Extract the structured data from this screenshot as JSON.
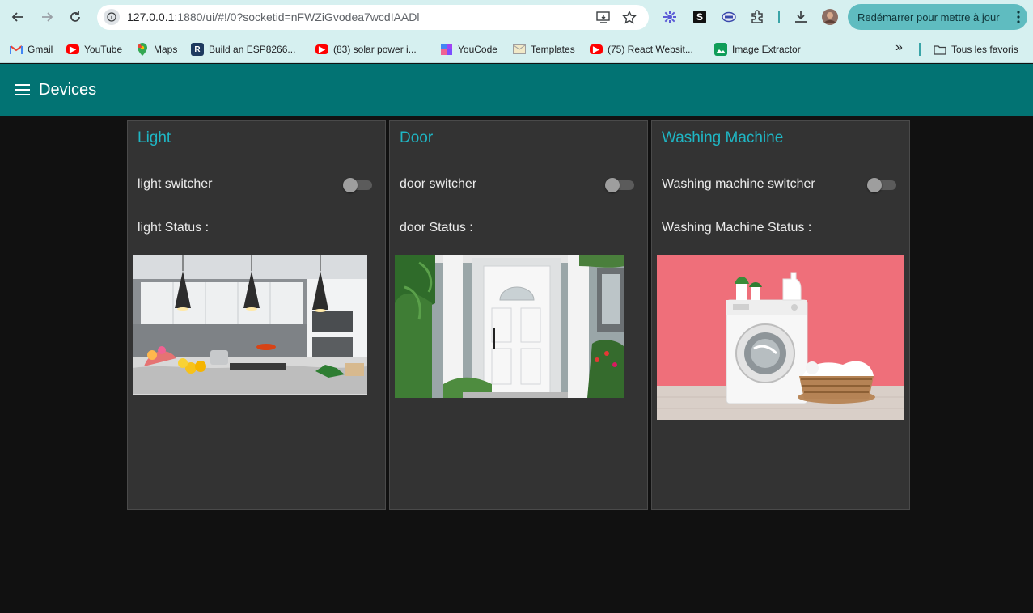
{
  "browser": {
    "url_host": "127.0.0.1",
    "url_rest": ":1880/ui/#!/0?socketid=nFWZiGvodea7wcdIAADl",
    "restart_label": "Redémarrer pour mettre à jour"
  },
  "bookmarks": [
    {
      "label": "Gmail",
      "icon": "gmail-icon"
    },
    {
      "label": "YouTube",
      "icon": "youtube-icon"
    },
    {
      "label": "Maps",
      "icon": "maps-icon"
    },
    {
      "label": "Build an ESP8266...",
      "icon": "r-icon"
    },
    {
      "label": "(83) solar power i...",
      "icon": "youtube-icon"
    },
    {
      "label": "YouCode",
      "icon": "youcode-icon"
    },
    {
      "label": "Templates",
      "icon": "envelope-icon"
    },
    {
      "label": "(75) React Websit...",
      "icon": "youtube-icon"
    },
    {
      "label": "Image Extractor",
      "icon": "image-icon"
    }
  ],
  "bookmarks_more": "»",
  "all_bookmarks_label": "Tous les favoris",
  "dashboard": {
    "title": "Devices",
    "colors": {
      "toolbar": "#027373",
      "accent": "#1fb6c4",
      "card": "#333333"
    },
    "cards": [
      {
        "title": "Light",
        "switch_label": "light switcher",
        "switch_on": false,
        "status_label": "light Status :",
        "image": "kitchen-image"
      },
      {
        "title": "Door",
        "switch_label": "door switcher",
        "switch_on": false,
        "status_label": "door Status :",
        "image": "door-image"
      },
      {
        "title": "Washing Machine",
        "switch_label": "Washing machine switcher",
        "switch_on": false,
        "status_label": "Washing Machine Status :",
        "image": "washing-machine-image"
      }
    ]
  }
}
